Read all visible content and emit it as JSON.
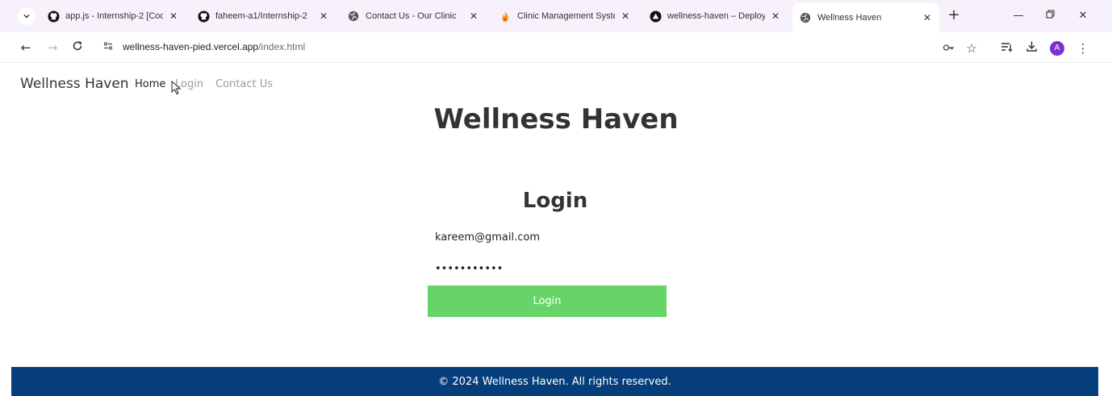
{
  "browser": {
    "tabs": [
      {
        "title": "app.js - Internship-2 [Code",
        "icon": "github-icon"
      },
      {
        "title": "faheem-a1/Internship-2",
        "icon": "github-icon"
      },
      {
        "title": "Contact Us - Our Clinic",
        "icon": "globe-icon"
      },
      {
        "title": "Clinic Management System",
        "icon": "flame-icon"
      },
      {
        "title": "wellness-haven – Deploym",
        "icon": "vercel-icon"
      },
      {
        "title": "Wellness Haven",
        "icon": "globe-icon",
        "active": true
      }
    ],
    "url": {
      "host": "wellness-haven-pied.vercel.app",
      "path": "/index.html"
    },
    "profile_initial": "A"
  },
  "site": {
    "brand": "Wellness Haven",
    "nav": {
      "home": "Home",
      "login": "Login",
      "contact": "Contact Us"
    },
    "hero_title": "Wellness Haven",
    "login_form": {
      "title": "Login",
      "email_value": "kareem@gmail.com",
      "password_value": "•••••••••••",
      "submit_label": "Login"
    },
    "footer": "© 2024 Wellness Haven. All rights reserved."
  },
  "colors": {
    "tabbar_bg": "#f7f1fb",
    "login_button": "#66d466",
    "footer_bg": "#053e7a",
    "avatar": "#7b2fcf"
  }
}
